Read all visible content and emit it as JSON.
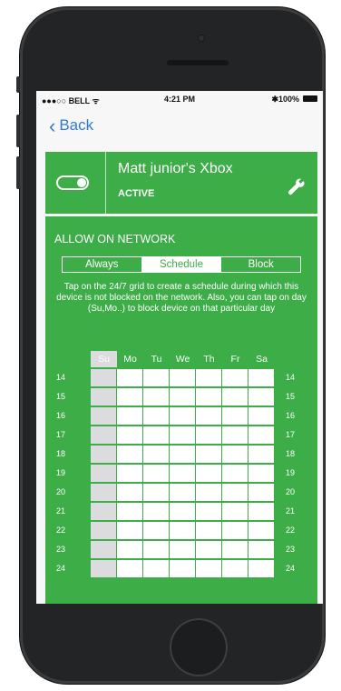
{
  "status_bar": {
    "carrier": "●●●○○ BELL ᯤ",
    "time": "4:21 PM",
    "battery": "✱100%"
  },
  "nav": {
    "back_label": "Back"
  },
  "device": {
    "name": "Matt junior's Xbox",
    "status": "ACTIVE",
    "enabled": true
  },
  "schedule": {
    "heading": "ALLOW ON NETWORK",
    "modes": [
      "Always",
      "Schedule",
      "Block"
    ],
    "selected_mode": "Schedule",
    "instructions": "Tap on the 24/7 grid to create a schedule during which this device is not blocked on the network. Also, you can tap on day (Su,Mo..) to block device on that particular day",
    "days": [
      "Su",
      "Mo",
      "Tu",
      "We",
      "Th",
      "Fr",
      "Sa"
    ],
    "blocked_day": "Su",
    "hours": [
      "14",
      "15",
      "16",
      "17",
      "18",
      "19",
      "20",
      "21",
      "22",
      "23",
      "24"
    ]
  },
  "colors": {
    "accent": "#3dad48",
    "link": "#2f7ad6",
    "blocked": "#dcdcde"
  }
}
